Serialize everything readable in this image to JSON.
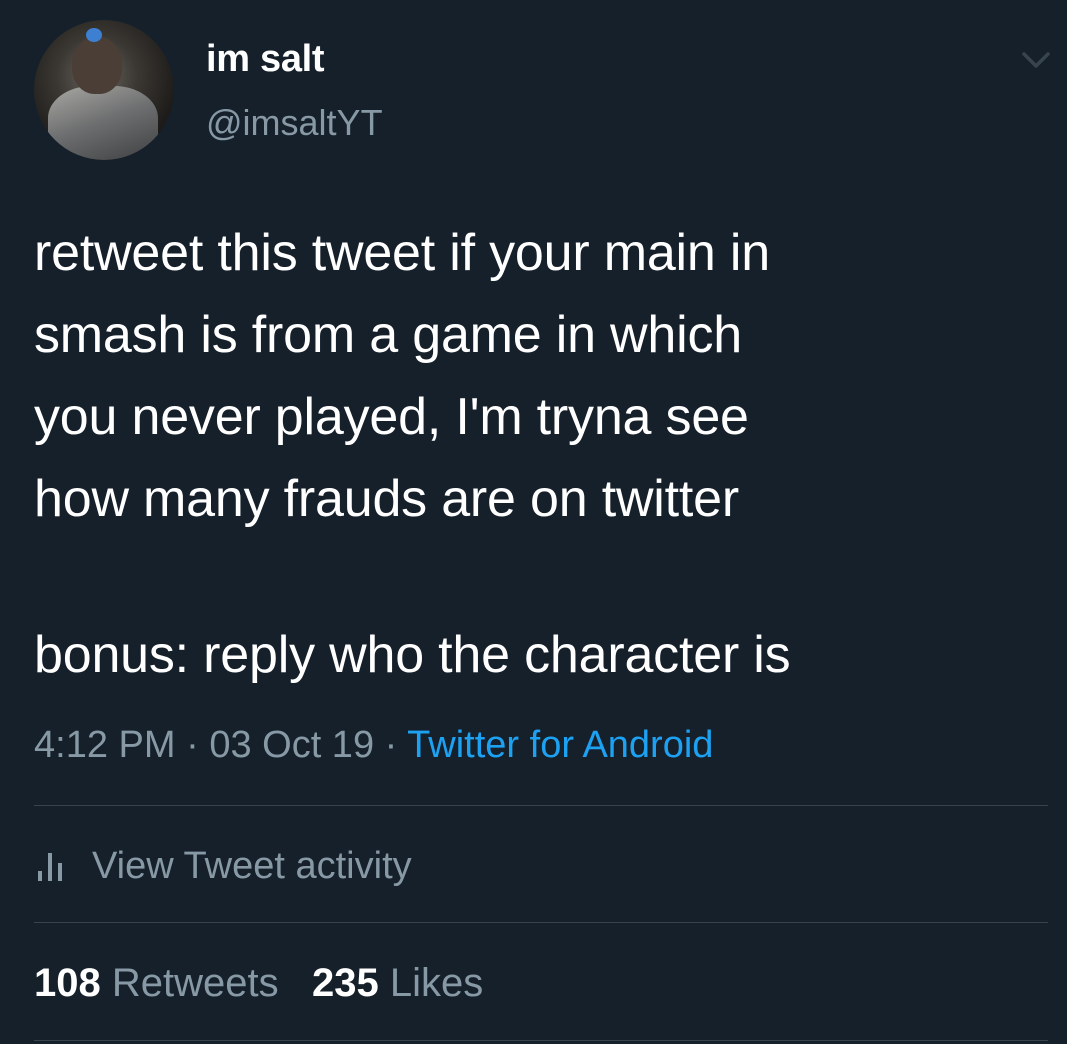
{
  "colors": {
    "background": "#15202b",
    "text_primary": "#ffffff",
    "text_secondary": "#8899a6",
    "link": "#1da1f2",
    "divider": "#38444d"
  },
  "author": {
    "display_name": "im salt",
    "handle": "@imsaltYT",
    "avatar": "user-avatar-photo"
  },
  "menu_icon": "chevron-down-icon",
  "tweet": {
    "text": "retweet this tweet if your main in\nsmash is from a game in which\nyou never played, I'm tryna see\nhow many frauds are on twitter",
    "bonus": "bonus: reply who the character is"
  },
  "meta": {
    "time": "4:12 PM",
    "separator1": " · ",
    "date": "03 Oct 19",
    "separator2": " · ",
    "source": "Twitter for Android"
  },
  "activity": {
    "icon": "bar-chart-icon",
    "label": "View Tweet activity"
  },
  "stats": {
    "retweets_count": "108",
    "retweets_label": "Retweets",
    "likes_count": "235",
    "likes_label": "Likes"
  }
}
